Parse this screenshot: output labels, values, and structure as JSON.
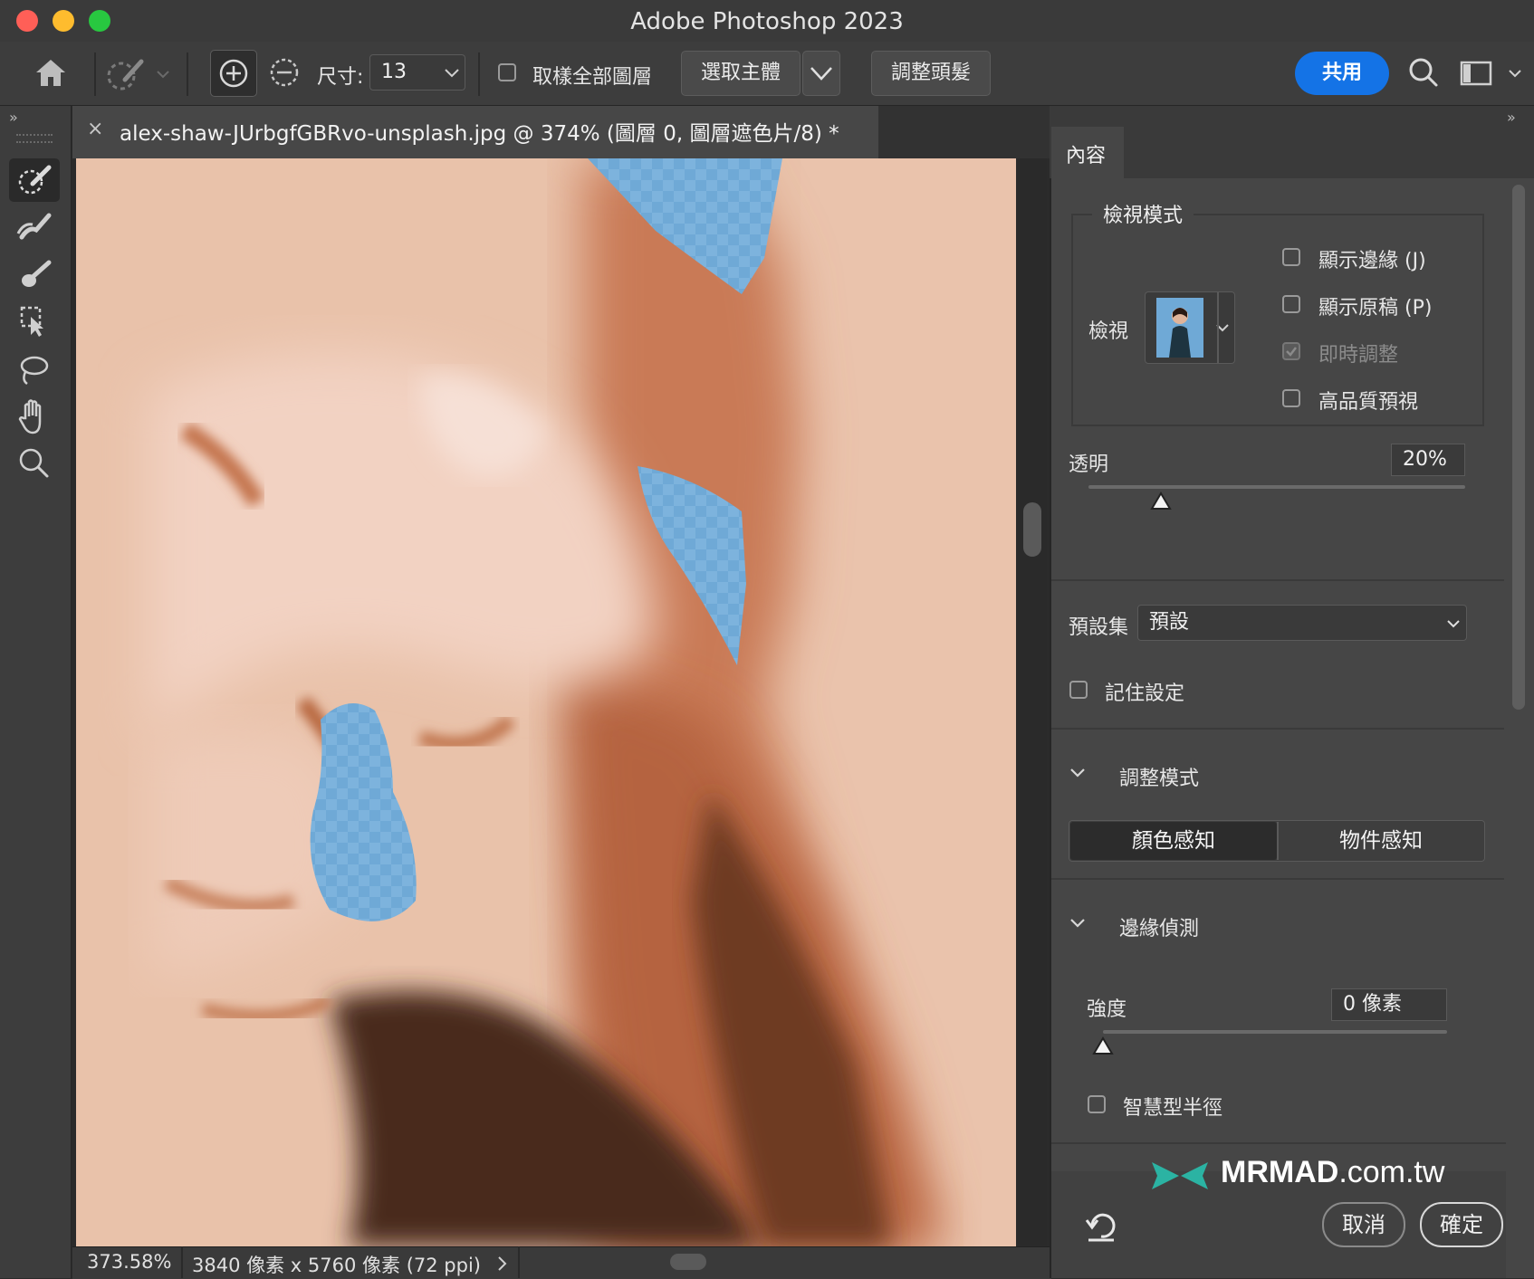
{
  "window": {
    "title": "Adobe Photoshop 2023"
  },
  "options_bar": {
    "size_label": "尺寸:",
    "size_value": "13",
    "sample_all_layers_label": "取樣全部圖層",
    "select_subject_label": "選取主體",
    "refine_hair_label": "調整頭髮",
    "share_label": "共用"
  },
  "document": {
    "tab_title": "alex-shaw-JUrbgfGBRvo-unsplash.jpg @ 374% (圖層 0, 圖層遮色片/8) *"
  },
  "status_bar": {
    "zoom": "373.58%",
    "doc_info": "3840 像素 x 5760 像素 (72 ppi)"
  },
  "properties": {
    "tab_label": "內容",
    "view_mode": {
      "group_title": "檢視模式",
      "view_label": "檢視",
      "options": [
        {
          "label": "顯示邊緣 (J)",
          "checked": false,
          "disabled": false
        },
        {
          "label": "顯示原稿 (P)",
          "checked": false,
          "disabled": false
        },
        {
          "label": "即時調整",
          "checked": true,
          "disabled": true
        },
        {
          "label": "高品質預視",
          "checked": false,
          "disabled": false
        }
      ]
    },
    "opacity": {
      "label": "透明",
      "value": "20%",
      "level": 0.2
    },
    "preset": {
      "label": "預設集",
      "value": "預設"
    },
    "remember_settings_label": "記住設定",
    "refine_mode": {
      "title": "調整模式",
      "color_aware_label": "顏色感知",
      "object_aware_label": "物件感知",
      "selected": "color_aware"
    },
    "edge_detection": {
      "title": "邊緣偵測",
      "radius_label": "強度",
      "radius_value": "0 像素",
      "radius_level": 0,
      "smart_radius_label": "智慧型半徑"
    },
    "watermark": {
      "brand": "MRMAD",
      "domain": ".com.tw"
    },
    "cancel_label": "取消",
    "ok_label": "確定"
  },
  "colors": {
    "accent_blue": "#1473e6",
    "close": "#ff5f57",
    "minimize": "#febc2e",
    "zoom": "#28c840",
    "mask_blue": "#6fa9d6"
  }
}
